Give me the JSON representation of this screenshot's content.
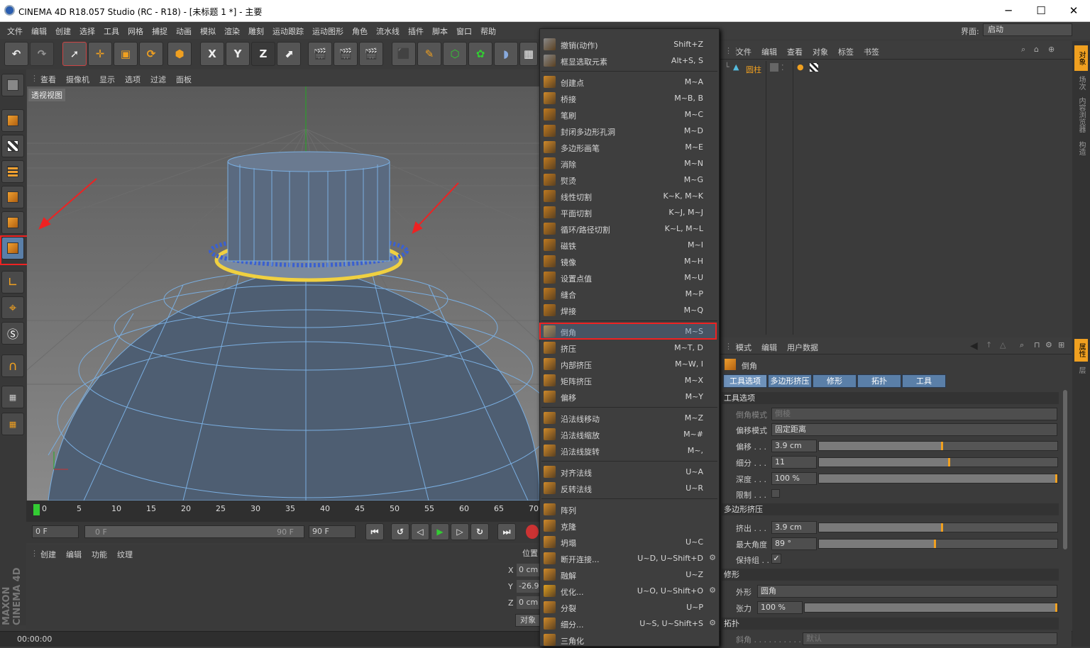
{
  "window": {
    "title": "CINEMA 4D R18.057 Studio (RC - R18) - [未标题 1 *] - 主要",
    "minimize": "─",
    "maximize": "☐",
    "close": "✕"
  },
  "menubar": {
    "items": [
      "文件",
      "编辑",
      "创建",
      "选择",
      "工具",
      "网格",
      "捕捉",
      "动画",
      "模拟",
      "渲染",
      "雕刻",
      "运动跟踪",
      "运动图形",
      "角色",
      "流水线",
      "插件",
      "脚本",
      "窗口",
      "帮助"
    ],
    "layout_label": "界面:",
    "layout_value": "启动"
  },
  "toolbar": {
    "axis_x": "X",
    "axis_y": "Y",
    "axis_z": "Z"
  },
  "viewport": {
    "menu": [
      "查看",
      "摄像机",
      "显示",
      "选项",
      "过滤",
      "面板"
    ],
    "label": "透视视图"
  },
  "timeline": {
    "ticks": [
      "0",
      "5",
      "10",
      "15",
      "20",
      "25",
      "30",
      "35",
      "40",
      "45",
      "50",
      "55",
      "60",
      "65",
      "70"
    ],
    "start": "0 F",
    "range_start": "0 F",
    "range_end": "90 F",
    "end": "90 F"
  },
  "material_panel": {
    "menu": [
      "创建",
      "编辑",
      "功能",
      "纹理"
    ]
  },
  "coord_panel": {
    "header": "位置",
    "x_label": "X",
    "x_value": "0 cm",
    "y_label": "Y",
    "y_value": "-26.9",
    "z_label": "Z",
    "z_value": "0 cm",
    "object_btn": "对象"
  },
  "status": {
    "time": "00:00:00"
  },
  "branding": {
    "maxon": "MAXON",
    "cinema": "CINEMA 4D"
  },
  "context_menu": {
    "items": [
      {
        "label": "撤销(动作)",
        "shortcut": "Shift+Z"
      },
      {
        "label": "框显选取元素",
        "shortcut": "Alt+S, S"
      },
      {
        "label": "创建点",
        "shortcut": "M~A"
      },
      {
        "label": "桥接",
        "shortcut": "M~B, B"
      },
      {
        "label": "笔刷",
        "shortcut": "M~C"
      },
      {
        "label": "封闭多边形孔洞",
        "shortcut": "M~D"
      },
      {
        "label": "多边形画笔",
        "shortcut": "M~E"
      },
      {
        "label": "消除",
        "shortcut": "M~N"
      },
      {
        "label": "熨烫",
        "shortcut": "M~G"
      },
      {
        "label": "线性切割",
        "shortcut": "K~K, M~K"
      },
      {
        "label": "平面切割",
        "shortcut": "K~J, M~J"
      },
      {
        "label": "循环/路径切割",
        "shortcut": "K~L, M~L"
      },
      {
        "label": "磁铁",
        "shortcut": "M~I"
      },
      {
        "label": "镜像",
        "shortcut": "M~H"
      },
      {
        "label": "设置点值",
        "shortcut": "M~U"
      },
      {
        "label": "缝合",
        "shortcut": "M~P"
      },
      {
        "label": "焊接",
        "shortcut": "M~Q"
      },
      {
        "label": "倒角",
        "shortcut": "M~S"
      },
      {
        "label": "挤压",
        "shortcut": "M~T, D"
      },
      {
        "label": "内部挤压",
        "shortcut": "M~W, I"
      },
      {
        "label": "矩阵挤压",
        "shortcut": "M~X"
      },
      {
        "label": "偏移",
        "shortcut": "M~Y"
      },
      {
        "label": "沿法线移动",
        "shortcut": "M~Z"
      },
      {
        "label": "沿法线缩放",
        "shortcut": "M~#"
      },
      {
        "label": "沿法线旋转",
        "shortcut": "M~,"
      },
      {
        "label": "对齐法线",
        "shortcut": "U~A"
      },
      {
        "label": "反转法线",
        "shortcut": "U~R"
      },
      {
        "label": "阵列",
        "shortcut": ""
      },
      {
        "label": "克隆",
        "shortcut": ""
      },
      {
        "label": "坍塌",
        "shortcut": "U~C"
      },
      {
        "label": "断开连接...",
        "shortcut": "U~D, U~Shift+D"
      },
      {
        "label": "融解",
        "shortcut": "U~Z"
      },
      {
        "label": "优化...",
        "shortcut": "U~O, U~Shift+O"
      },
      {
        "label": "分裂",
        "shortcut": "U~P"
      },
      {
        "label": "细分...",
        "shortcut": "U~S, U~Shift+S"
      },
      {
        "label": "三角化",
        "shortcut": ""
      }
    ]
  },
  "object_manager": {
    "menu": [
      "文件",
      "编辑",
      "查看",
      "对象",
      "标签",
      "书签"
    ],
    "object_name": "圆柱"
  },
  "right_tabs": {
    "top": "对象",
    "t2": "场次",
    "t3": "内容浏览器",
    "t4": "构造",
    "bottom": "属性",
    "b2": "层"
  },
  "attributes": {
    "menu": [
      "模式",
      "编辑",
      "用户数据"
    ],
    "tool_name": "倒角",
    "tabs": [
      "工具选项",
      "多边形挤压",
      "修形",
      "拓扑",
      "工具"
    ],
    "sec_tool": "工具选项",
    "bevel_mode_label": "倒角模式",
    "bevel_mode_value": "倒棱",
    "offset_mode_label": "偏移模式",
    "offset_mode_value": "固定距离",
    "offset_label": "偏移 . . .",
    "offset_value": "3.9 cm",
    "offset_level": 0.52,
    "subdiv_label": "细分 . . .",
    "subdiv_value": "11",
    "subdiv_level": 0.55,
    "depth_label": "深度 . . .",
    "depth_value": "100 %",
    "depth_level": 1.0,
    "limit_label": "限制 . . .",
    "sec_extrude": "多边形挤压",
    "extrude_label": "挤出 . . .",
    "extrude_value": "3.9 cm",
    "extrude_level": 0.52,
    "maxangle_label": "最大角度",
    "maxangle_value": "89 °",
    "maxangle_level": 0.49,
    "keepgroup_label": "保持组 . .",
    "keepgroup_check": "✓",
    "sec_shape": "修形",
    "shape_label": "外形",
    "shape_value": "圆角",
    "tension_label": "张力",
    "tension_value": "100 %",
    "tension_level": 1.0,
    "sec_topo": "拓扑",
    "bevel_label": "斜角 . . . . . . . . . .",
    "bevel_value": "默认"
  }
}
